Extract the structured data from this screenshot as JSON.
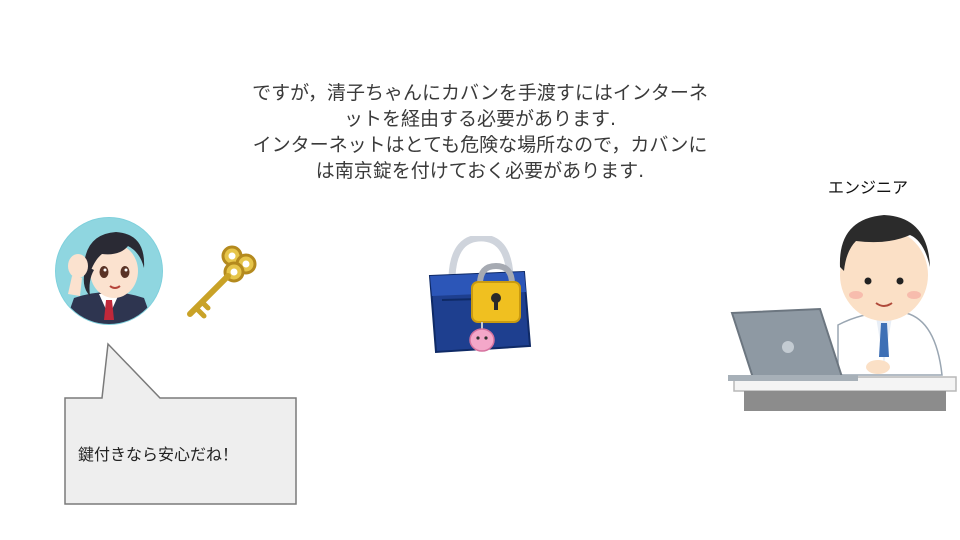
{
  "slide": {
    "caption_lines": [
      "ですが，清子ちゃんにカバンを手渡すにはインターネ",
      "ットを経由する必要があります.",
      "インターネットはとても危険な場所なので，カバンに",
      "は南京錠を付けておく必要があります."
    ],
    "engineer_label": "エンジニア",
    "speech_bubble_text": "鍵付きなら安心だね！",
    "icons": [
      "girl-avatar",
      "key-icon",
      "locked-bag-icon",
      "engineer-laptop-icon"
    ],
    "colors": {
      "avatar_bg": "#7fd0dc",
      "key_gold": "#c9a227",
      "bag_navy": "#1e3f8f",
      "padlock_gold": "#f0c020",
      "bubble_fill": "#eeeeee",
      "laptop_gray": "#8e99a3"
    }
  }
}
